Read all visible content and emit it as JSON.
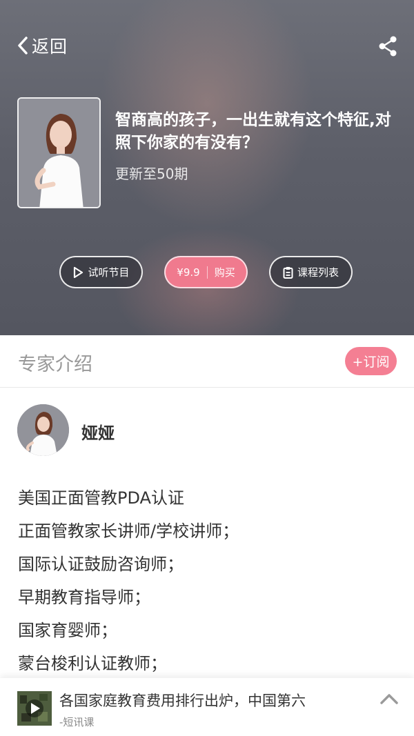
{
  "header": {
    "back_label": "返回",
    "back_icon": "chevron-left-icon",
    "share_icon": "share-icon"
  },
  "course": {
    "title": "智商高的孩子，一出生就有这个特征,对照下你家的有没有？",
    "update_status": "更新至50期"
  },
  "actions": {
    "trial_label": "试听节目",
    "price": "¥9.9",
    "buy_label": "购买",
    "list_label": "课程列表"
  },
  "expert": {
    "section_title": "专家介绍",
    "subscribe_label": "+订阅",
    "name": "娅娅",
    "bio": [
      "美国正面管教PDA认证",
      "正面管教家长讲师/学校讲师；",
      "国际认证鼓励咨询师；",
      "早期教育指导师；",
      "国家育婴师；",
      "蒙台梭利认证教师；"
    ]
  },
  "player": {
    "title": "各国家庭教育费用排行出炉，中国第六",
    "subtitle": "-短讯课"
  },
  "colors": {
    "accent_pink": "#f47f93",
    "buy_pink": "#f07a8e",
    "hero_bg": "#5d5f69"
  }
}
